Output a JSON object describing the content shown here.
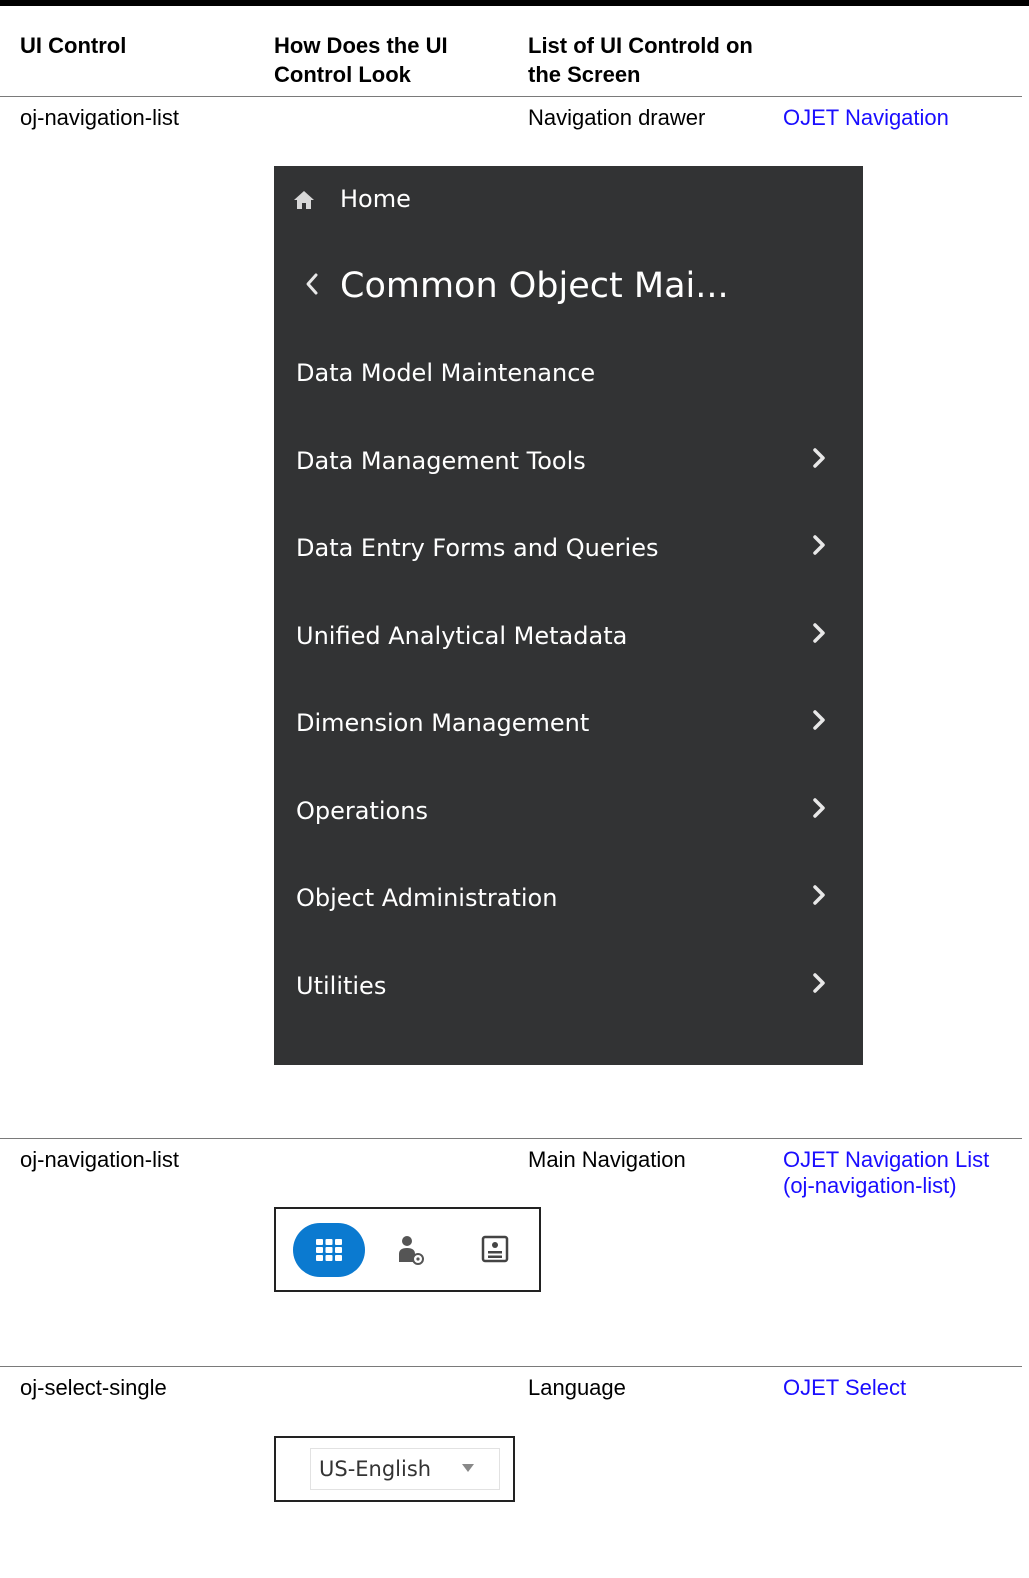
{
  "table": {
    "headers": [
      "UI Control",
      "How Does the UI Control Look",
      "List of UI Controld on the Screen"
    ],
    "rows": [
      {
        "control": "oj-navigation-list",
        "screen_control": "Navigation drawer",
        "reference": "OJET Navigation",
        "preview": {
          "home_label": "Home",
          "breadcrumb": "Common Object Mai...",
          "items": [
            "Data Model Maintenance",
            "Data Management Tools",
            "Data Entry Forms and Queries",
            "Unified Analytical Metadata",
            "Dimension Management",
            "Operations",
            "Object Administration",
            "Utilities"
          ]
        }
      },
      {
        "control": "oj-navigation-list",
        "screen_control": "Main Navigation",
        "reference_line1": "OJET Navigation List",
        "reference_line2": "(oj-navigation-list)",
        "preview": {
          "icons": [
            "grid-icon",
            "user-settings-icon",
            "document-card-icon"
          ],
          "active_color": "#0B7AD0"
        }
      },
      {
        "control": "oj-select-single",
        "screen_control": "Language",
        "reference": "OJET Select",
        "preview": {
          "selected_value": "US-English"
        }
      }
    ]
  },
  "colors": {
    "drawer_background": "#323334",
    "link": "#1A0DFF",
    "accent": "#0B7AD0"
  }
}
